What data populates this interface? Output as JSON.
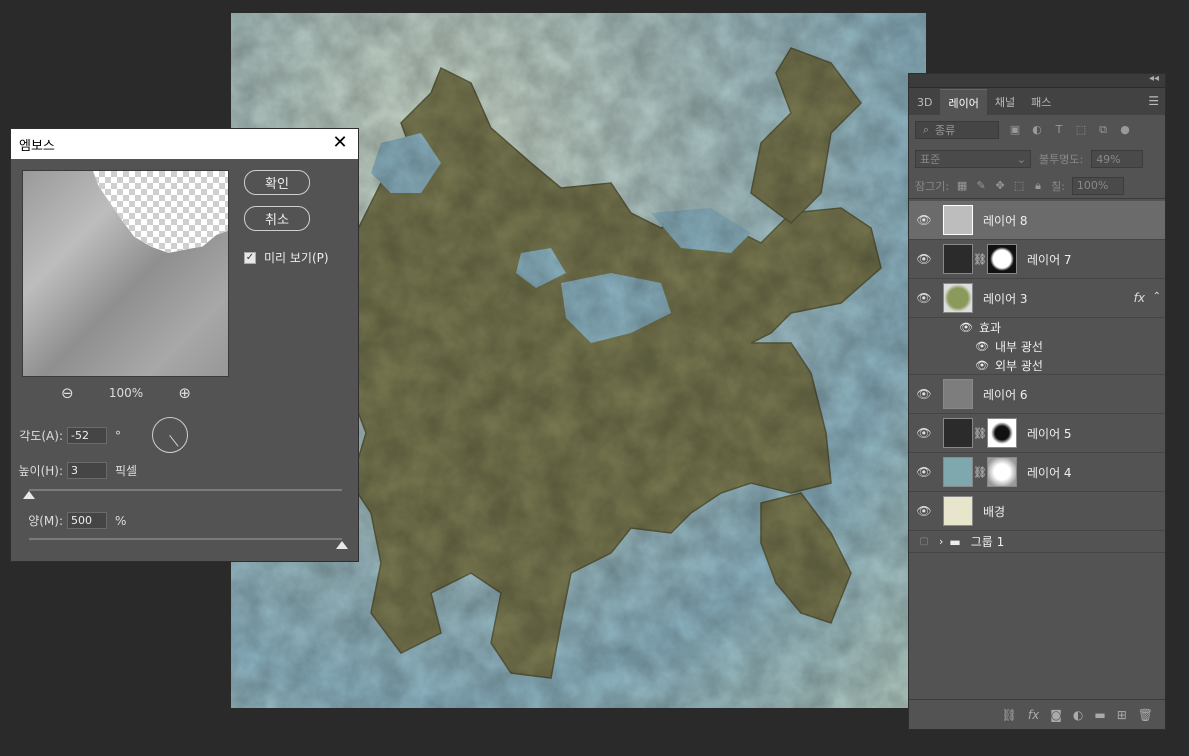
{
  "dialog": {
    "title": "엠보스",
    "ok_label": "확인",
    "cancel_label": "취소",
    "preview_label": "미리 보기(P)",
    "preview_checked": true,
    "zoom_level": "100%",
    "zoom_out_icon": "zoom-out-icon",
    "zoom_in_icon": "zoom-in-icon",
    "angle": {
      "label": "각도(A):",
      "value": "-52",
      "unit": "°"
    },
    "height": {
      "label": "높이(H):",
      "value": "3",
      "unit": "픽셀"
    },
    "amount": {
      "label": "양(M):",
      "value": "500",
      "unit": "%"
    },
    "height_slider_fraction": 0.0,
    "amount_slider_fraction": 1.0
  },
  "panel": {
    "tabs": [
      {
        "label": "3D",
        "active": false
      },
      {
        "label": "레이어",
        "active": true
      },
      {
        "label": "채널",
        "active": false
      },
      {
        "label": "패스",
        "active": false
      }
    ],
    "filter_label": "종류",
    "blend_mode": "표준",
    "opacity_label": "불투명도:",
    "opacity_value": "49%",
    "lock_label": "잠그기:",
    "fill_label": "칠:",
    "fill_value": "100%",
    "layers": [
      {
        "name": "레이어 8",
        "selected": true,
        "has_mask": false,
        "thumb_color": "#bdbdbd"
      },
      {
        "name": "레이어 7",
        "selected": false,
        "has_mask": true,
        "thumb_color": "#2b2b2b",
        "mask_color": "#ffffff"
      },
      {
        "name": "레이어 3",
        "selected": false,
        "has_mask": false,
        "thumb_color": "#8a9a5a",
        "fx": "fx"
      },
      {
        "name": "레이어 6",
        "selected": false,
        "has_mask": false,
        "thumb_color": "#7d7d7d"
      },
      {
        "name": "레이어 5",
        "selected": false,
        "has_mask": true,
        "thumb_color": "#2b2b2b",
        "mask_color": "#ffffff"
      },
      {
        "name": "레이어 4",
        "selected": false,
        "has_mask": true,
        "thumb_color": "#7fa7ae",
        "mask_color": "#e8e8e8"
      },
      {
        "name": "배경",
        "selected": false,
        "has_mask": false,
        "thumb_color": "#e7e6cc"
      }
    ],
    "effects_label": "효과",
    "effects": [
      "내부 광선",
      "외부 광선"
    ],
    "group_name": "그룹 1"
  },
  "colors": {
    "land": "#7a7a52",
    "water": "#8fb7c6",
    "ui_bg": "#535353",
    "dark_bg": "#2a2a2a"
  }
}
